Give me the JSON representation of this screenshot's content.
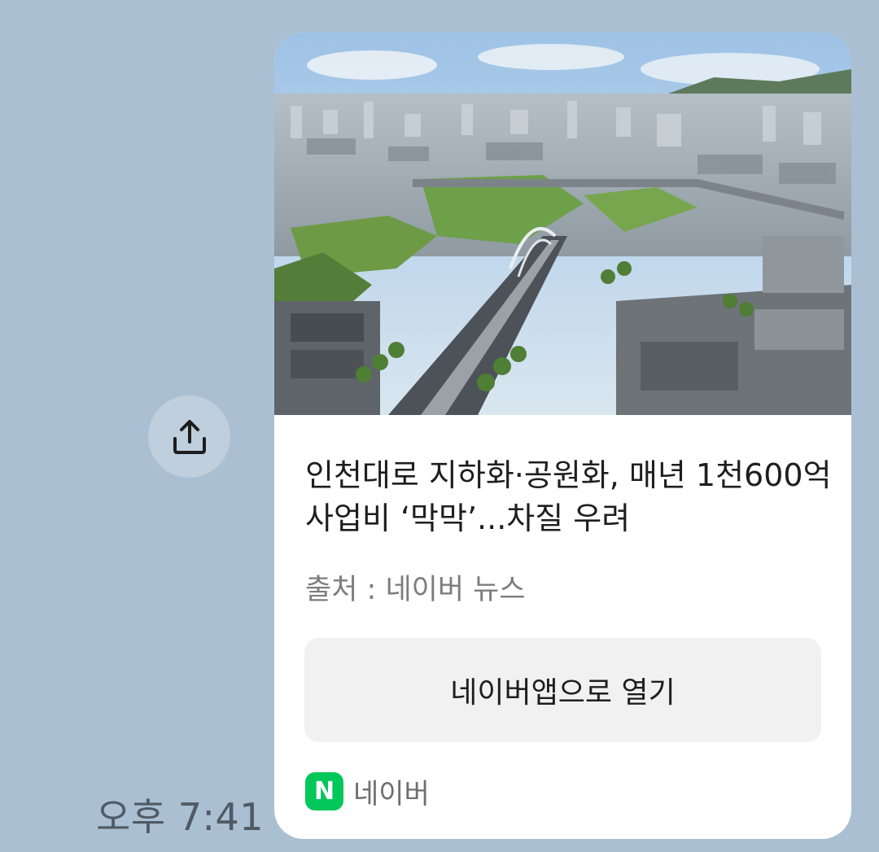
{
  "message": {
    "time": "오후 7:41"
  },
  "share_button": {
    "icon": "share-upload-icon"
  },
  "card": {
    "headline": "인천대로 지하화·공원화, 매년 1천600억 사업비 ‘막막’...차질 우려",
    "source": "출처 : 네이버 뉴스",
    "open_button_label": "네이버앱으로 열기",
    "footer_logo_letter": "N",
    "footer_label": "네이버"
  },
  "colors": {
    "background": "#aabfd2",
    "naver_green": "#03c75a",
    "card": "#ffffff",
    "button_bg": "#f1f1f1"
  }
}
